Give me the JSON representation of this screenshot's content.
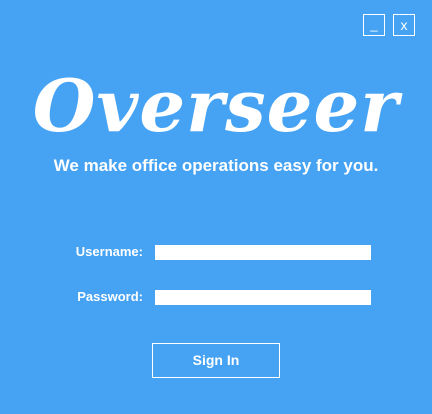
{
  "window": {
    "minimize_label": "_",
    "close_label": "x",
    "background_color": "#46a3f3"
  },
  "branding": {
    "logo_text": "Overseer",
    "tagline": "We make office operations easy for you."
  },
  "form": {
    "username_label": "Username:",
    "username_value": "",
    "password_label": "Password:",
    "password_value": "",
    "submit_label": "Sign In"
  }
}
